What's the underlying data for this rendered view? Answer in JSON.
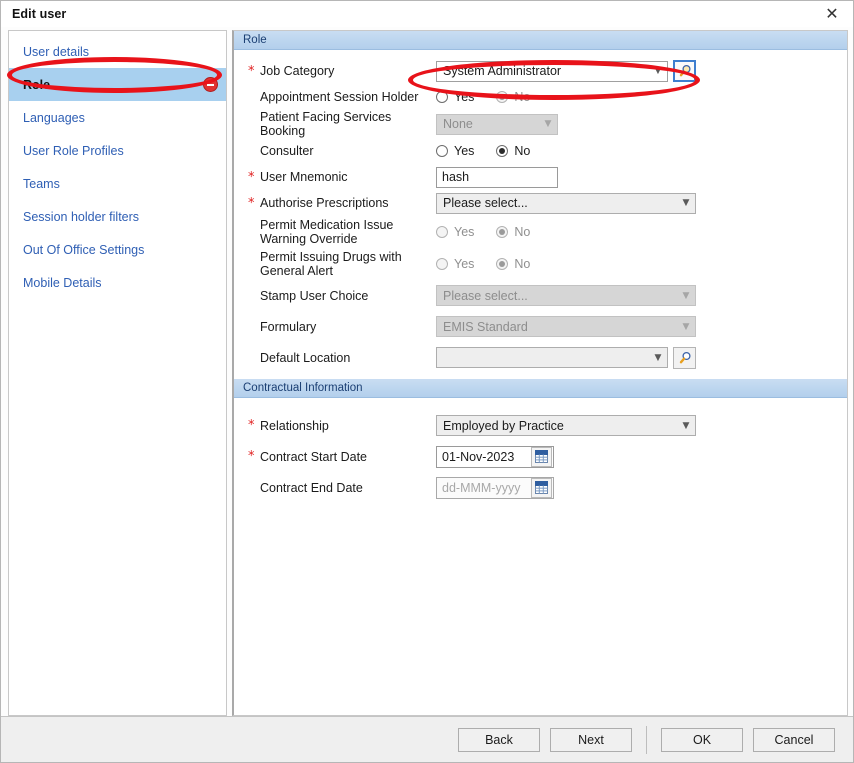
{
  "window": {
    "title": "Edit user",
    "close_icon": "close-icon"
  },
  "sidebar": {
    "items": [
      {
        "label": "User details",
        "selected": false,
        "error": false
      },
      {
        "label": "Role",
        "selected": true,
        "error": true
      },
      {
        "label": "Languages",
        "selected": false,
        "error": false
      },
      {
        "label": "User Role Profiles",
        "selected": false,
        "error": false
      },
      {
        "label": "Teams",
        "selected": false,
        "error": false
      },
      {
        "label": "Session holder filters",
        "selected": false,
        "error": false
      },
      {
        "label": "Out Of Office Settings",
        "selected": false,
        "error": false
      },
      {
        "label": "Mobile Details",
        "selected": false,
        "error": false
      }
    ]
  },
  "role_section": {
    "header": "Role",
    "job_category": {
      "required": "*",
      "label": "Job Category",
      "value": "System Administrator",
      "caret": "chevron-down-icon",
      "lookup_icon": "magnifier-icon"
    },
    "appointment_session_holder": {
      "required": "",
      "label": "Appointment Session Holder",
      "options": [
        "Yes",
        "No"
      ],
      "selected": "No",
      "disabled": false
    },
    "patient_facing_services_booking": {
      "required": "",
      "label": "Patient Facing Services Booking",
      "value": "None",
      "disabled": true,
      "caret": "chevron-down-icon"
    },
    "consulter": {
      "required": "",
      "label": "Consulter",
      "options": [
        "Yes",
        "No"
      ],
      "selected": "No",
      "disabled": false
    },
    "user_mnemonic": {
      "required": "*",
      "label": "User Mnemonic",
      "value": "hash"
    },
    "authorise_prescriptions": {
      "required": "*",
      "label": "Authorise Prescriptions",
      "value": "Please select...",
      "disabled": false,
      "caret": "chevron-down-icon"
    },
    "permit_medication_issue_warning_override": {
      "required": "",
      "label": "Permit Medication Issue Warning Override",
      "options": [
        "Yes",
        "No"
      ],
      "selected": "No",
      "disabled": true
    },
    "permit_issuing_drugs_general_alert": {
      "required": "",
      "label": "Permit Issuing Drugs with General Alert",
      "options": [
        "Yes",
        "No"
      ],
      "selected": "No",
      "disabled": true
    },
    "stamp_user_choice": {
      "required": "",
      "label": "Stamp User Choice",
      "value": "Please select...",
      "disabled": true,
      "caret": "chevron-down-icon"
    },
    "formulary": {
      "required": "",
      "label": "Formulary",
      "value": "EMIS Standard",
      "disabled": true,
      "caret": "chevron-down-icon"
    },
    "default_location": {
      "required": "",
      "label": "Default Location",
      "value": "",
      "disabled": false,
      "caret": "chevron-down-icon",
      "lookup_icon": "magnifier-icon"
    }
  },
  "contractual_section": {
    "header": "Contractual Information",
    "relationship": {
      "required": "*",
      "label": "Relationship",
      "value": "Employed by Practice",
      "caret": "chevron-down-icon"
    },
    "contract_start_date": {
      "required": "*",
      "label": "Contract Start Date",
      "value": "01-Nov-2023",
      "placeholder": "dd-MMM-yyyy",
      "calendar_icon": "calendar-icon"
    },
    "contract_end_date": {
      "required": "",
      "label": "Contract End Date",
      "value": "",
      "placeholder": "dd-MMM-yyyy",
      "calendar_icon": "calendar-icon"
    }
  },
  "footer": {
    "back_label": "Back",
    "next_label": "Next",
    "ok_label": "OK",
    "cancel_label": "Cancel"
  },
  "annotations": {
    "accent_color": "#e8131a",
    "highlight_color": "#a8d0ef",
    "error_color": "#e03232"
  }
}
